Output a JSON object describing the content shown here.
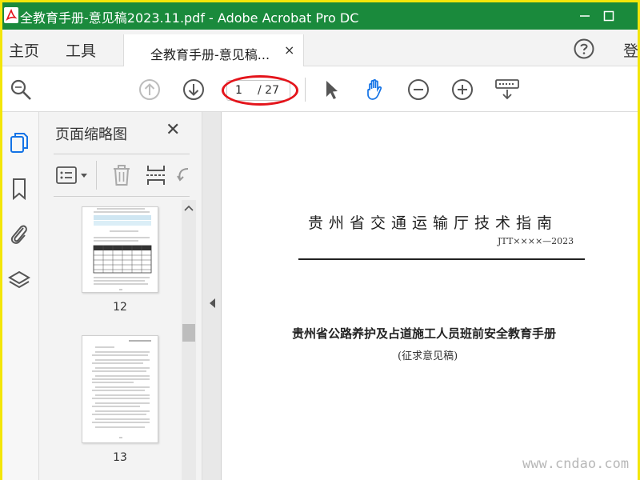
{
  "window": {
    "title": "全教育手册-意见稿2023.11.pdf - Adobe Acrobat Pro DC",
    "buttons": [
      "minimize",
      "maximize"
    ]
  },
  "menu": {
    "home": "主页",
    "tools": "工具",
    "sign_in": "登"
  },
  "tab": {
    "label": "全教育手册-意见稿...",
    "close": "×"
  },
  "toolbar": {
    "page_current": "1",
    "page_total": "/ 27",
    "highlight_color": "#e4141b"
  },
  "sidebar": {
    "items": [
      "pages-icon",
      "bookmark-icon",
      "attachment-icon",
      "layers-icon"
    ]
  },
  "thumbnails": {
    "title": "页面缩略图",
    "close": "✕",
    "pages": [
      {
        "number": "12"
      },
      {
        "number": "13"
      }
    ]
  },
  "document": {
    "org": "贵州省交通运输厅技术指南",
    "code": "JTT××××—2023",
    "title": "贵州省公路养护及占道施工人员班前安全教育手册",
    "subtitle": "(征求意见稿)"
  },
  "watermark": "www.cndao.com",
  "colors": {
    "titlebar": "#1a8a3c",
    "accent_blue": "#1473e6",
    "frame": "#f3e60a"
  }
}
